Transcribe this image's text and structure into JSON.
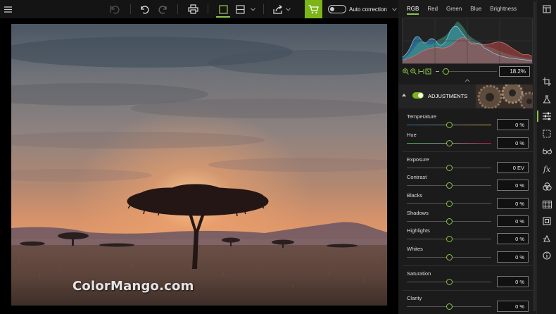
{
  "toolbar": {
    "auto_correction_label": "Auto correction",
    "icons": [
      "menu-icon",
      "undo-all-icon",
      "undo-icon",
      "redo-icon",
      "print-icon",
      "single-view-icon",
      "split-view-icon",
      "chevron-down-icon",
      "share-icon",
      "chevron-down-icon",
      "cart-icon",
      "toggle",
      "chevron-down-icon"
    ],
    "accent_color": "#7cb518"
  },
  "photo": {
    "watermark": "ColorMango.com"
  },
  "histogram": {
    "tabs": [
      "RGB",
      "Red",
      "Green",
      "Blue",
      "Brightness"
    ],
    "active_tab": "RGB",
    "zoom_value": "18.2%"
  },
  "adjustments": {
    "title": "ADJUSTMENTS",
    "enabled": true,
    "rows": [
      {
        "label": "Temperature",
        "value": "0 %",
        "position": 0.5
      },
      {
        "label": "Hue",
        "value": "0 %",
        "position": 0.5
      },
      {
        "label": "Exposure",
        "value": "0 EV",
        "position": 0.5
      },
      {
        "label": "Contrast",
        "value": "0 %",
        "position": 0.5
      },
      {
        "label": "Blacks",
        "value": "0 %",
        "position": 0.5
      },
      {
        "label": "Shadows",
        "value": "0 %",
        "position": 0.5
      },
      {
        "label": "Highlights",
        "value": "0 %",
        "position": 0.5
      },
      {
        "label": "Whites",
        "value": "0 %",
        "position": 0.5
      },
      {
        "label": "Saturation",
        "value": "0 %",
        "position": 0.5
      },
      {
        "label": "Clarity",
        "value": "0 %",
        "position": 0.5
      }
    ]
  },
  "sidebar": {
    "icons": [
      "layout-icon",
      "crop-icon",
      "flask-icon",
      "sliders-icon",
      "selection-icon",
      "glasses-icon",
      "fx-icon",
      "color-circles-icon",
      "film-strip-icon",
      "frame-icon",
      "transform-icon",
      "info-icon"
    ],
    "active": "sliders-icon",
    "fx_text": "fx"
  }
}
